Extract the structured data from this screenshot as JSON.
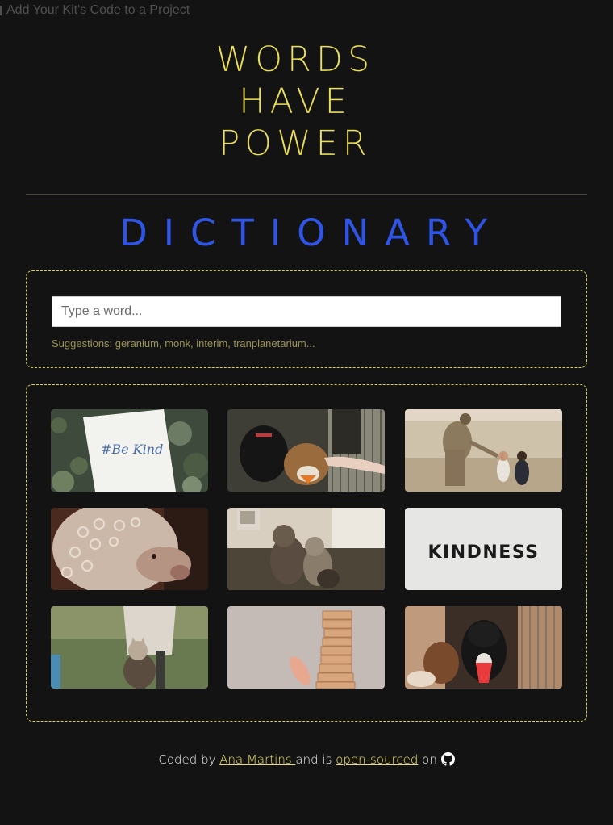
{
  "topbar": {
    "text": "Add Your Kit's Code to a Project"
  },
  "logo": {
    "lines": [
      "WORDS",
      "HAVE",
      "POWER"
    ]
  },
  "title": "DICTIONARY",
  "search": {
    "placeholder": "Type a word...",
    "value": "",
    "suggestions": "Suggestions: geranium, monk, interim, tranplanetarium..."
  },
  "images": [
    {
      "name": "photo-be-kind-note",
      "caption": "#Be Kind"
    },
    {
      "name": "photo-dogs-at-fence"
    },
    {
      "name": "photo-soldier-children"
    },
    {
      "name": "photo-curly-alpaca"
    },
    {
      "name": "photo-cats-outdoors"
    },
    {
      "name": "photo-kindness-text",
      "caption": "KINDNESS"
    },
    {
      "name": "photo-cat-with-person"
    },
    {
      "name": "photo-wooden-blocks"
    },
    {
      "name": "photo-dog-in-cage"
    }
  ],
  "footer": {
    "prefix": "Coded by",
    "author": "Ana Martins ",
    "middle": "and is",
    "link": "open-sourced",
    "suffix": "on",
    "icon": "github-icon"
  },
  "colors": {
    "background": "#131313",
    "logo": "#ece05a",
    "title": "#2f55e6",
    "border": "#d8cf4c",
    "suggestions": "#9a9452"
  }
}
